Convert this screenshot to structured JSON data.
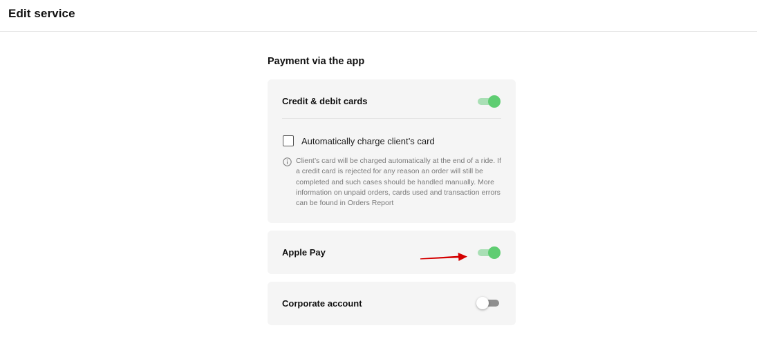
{
  "header": {
    "title": "Edit service"
  },
  "section": {
    "title": "Payment via the app"
  },
  "cards": {
    "credit": {
      "label": "Credit & debit cards",
      "enabled": true,
      "checkbox_label": "Automatically charge client’s card",
      "checkbox_checked": false,
      "info_text": "Client’s card will be charged automatically at the end of a ride. If a credit card is rejected for any reason an order will still be completed and such cases should be handled manually. More information on unpaid orders, cards used and transaction errors can be found in Orders Report"
    },
    "apple_pay": {
      "label": "Apple Pay",
      "enabled": true
    },
    "corporate": {
      "label": "Corporate account",
      "enabled": false
    }
  },
  "icons": {
    "info": "info-icon",
    "annotation": "red-arrow-icon"
  },
  "colors": {
    "toggle_on": "#5fcd72",
    "toggle_on_track": "#a9dfb5",
    "toggle_off_track": "#8f8f8f",
    "annotation_arrow": "#d40000"
  }
}
